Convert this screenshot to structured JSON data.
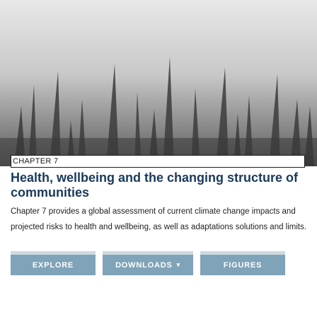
{
  "chapter": {
    "label": "CHAPTER 7",
    "title": "Health, wellbeing and the changing structure of communities",
    "description": "Chapter 7 provides a global assessment of current climate change impacts and projected risks to health and wellbeing, as well as adaptations solutions and limits."
  },
  "buttons": {
    "explore": "EXPLORE",
    "downloads": "DOWNLOADS",
    "figures": "FIGURES",
    "downloads_caret": "▾"
  },
  "colors": {
    "title": "#1a3a5a",
    "button_bg": "#7fa3b8"
  },
  "hero": {
    "image": "chapter-cover-photo"
  }
}
